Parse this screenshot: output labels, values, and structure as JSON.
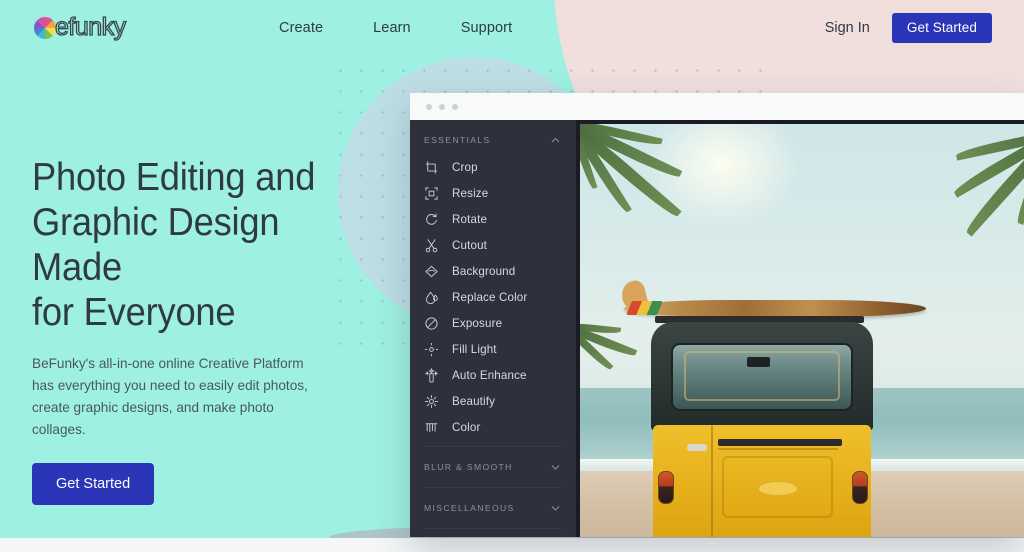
{
  "brand": {
    "name": "befunky",
    "logo_icon": "color-wheel-icon"
  },
  "nav": {
    "links": [
      {
        "label": "Create"
      },
      {
        "label": "Learn"
      },
      {
        "label": "Support"
      }
    ],
    "sign_in_label": "Sign In",
    "get_started_label": "Get Started"
  },
  "hero": {
    "heading_line1": "Photo Editing and",
    "heading_line2": "Graphic Design Made",
    "heading_line3": "for Everyone",
    "body": "BeFunky's all-in-one online Creative Platform has everything you need to easily edit photos, create graphic designs, and make photo collages.",
    "cta_label": "Get Started"
  },
  "app": {
    "window_dots": 3,
    "sidebar": {
      "sections": [
        {
          "title": "ESSENTIALS",
          "state": "expanded",
          "chevron": "chevron-up-icon",
          "items": [
            {
              "label": "Crop",
              "icon": "crop-icon"
            },
            {
              "label": "Resize",
              "icon": "resize-icon"
            },
            {
              "label": "Rotate",
              "icon": "rotate-icon"
            },
            {
              "label": "Cutout",
              "icon": "scissors-icon"
            },
            {
              "label": "Background",
              "icon": "background-diamond-icon"
            },
            {
              "label": "Replace Color",
              "icon": "droplet-icon"
            },
            {
              "label": "Exposure",
              "icon": "exposure-icon"
            },
            {
              "label": "Fill Light",
              "icon": "fill-light-icon"
            },
            {
              "label": "Auto Enhance",
              "icon": "auto-enhance-wand-icon"
            },
            {
              "label": "Beautify",
              "icon": "beautify-flower-icon"
            },
            {
              "label": "Color",
              "icon": "color-sliders-icon"
            }
          ]
        },
        {
          "title": "BLUR & SMOOTH",
          "state": "collapsed",
          "chevron": "chevron-down-icon",
          "items": []
        },
        {
          "title": "MISCELLANEOUS",
          "state": "collapsed",
          "chevron": "chevron-down-icon",
          "items": []
        }
      ]
    },
    "photo": {
      "description": "Yellow vintage VW van with surfboard on roof parked on a tropical beach with palm fronds and ocean"
    }
  },
  "colors": {
    "background_mint": "#9ef0e3",
    "blob_pink": "#f0dfdd",
    "circle_blue": "#c3dbe6",
    "accent_blue": "#2b35b8",
    "text_dark": "#2f3a44",
    "sidebar_dark": "#2e303c",
    "canvas_dark": "#1a1b24",
    "van_yellow": "#efc02c"
  }
}
